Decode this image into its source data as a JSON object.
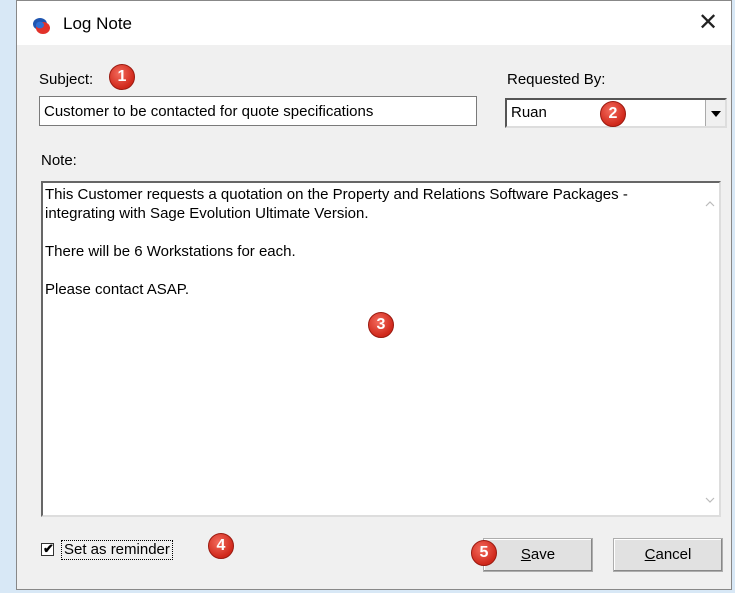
{
  "window": {
    "title": "Log Note",
    "close_glyph": "✕"
  },
  "form": {
    "subject_label": "Subject:",
    "subject_value": "Customer to be contacted for quote specifications",
    "requested_by_label": "Requested By:",
    "requested_by_value": "Ruan",
    "note_label": "Note:",
    "note_paragraphs": [
      "This Customer requests a quotation on the Property and Relations Software Packages - integrating with Sage Evolution Ultimate Version.",
      "There will be 6 Workstations for each.",
      "Please contact ASAP."
    ],
    "reminder_label": "Set as reminder",
    "reminder_checked": true,
    "check_glyph": "✔"
  },
  "buttons": {
    "save_access": "S",
    "save_rest": "ave",
    "cancel_access": "C",
    "cancel_rest": "ancel"
  },
  "badges": [
    "1",
    "2",
    "3",
    "4",
    "5"
  ],
  "colors": {
    "badge": "#d0281b",
    "dialog_bg": "#f0f0f0",
    "desktop_bg": "#d8e8f6"
  },
  "icons": {
    "app": "chat-bubble-icon",
    "close": "close-icon",
    "dropdown": "chevron-down-icon"
  }
}
